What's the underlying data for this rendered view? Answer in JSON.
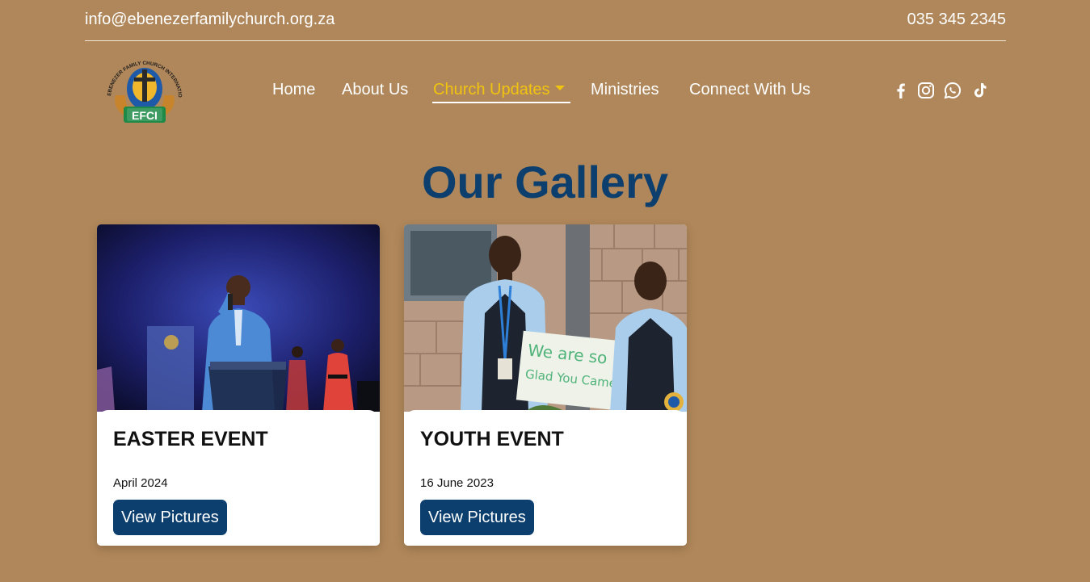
{
  "topbar": {
    "email": "info@ebenezerfamilychurch.org.za",
    "phone": "035 345 2345"
  },
  "logo": {
    "ring_text": "EBENEZER FAMILY CHURCH INTERNATIONAL",
    "badge_text": "EFCI"
  },
  "nav": {
    "items": [
      {
        "label": "Home"
      },
      {
        "label": "About Us"
      },
      {
        "label": "Church Updates"
      },
      {
        "label": "Ministries"
      },
      {
        "label": "Connect With Us"
      }
    ],
    "active_color": "#f1c40f"
  },
  "social": [
    "facebook-icon",
    "instagram-icon",
    "whatsapp-icon",
    "tiktok-icon"
  ],
  "gallery": {
    "title": "Our Gallery",
    "cards": [
      {
        "title": "EASTER EVENT",
        "date": "April 2024",
        "button": "View Pictures"
      },
      {
        "title": "YOUTH EVENT",
        "date": "16 June 2023",
        "button": "View Pictures",
        "sign_text": "We are so Glad You Came"
      }
    ]
  },
  "colors": {
    "background": "#b0875a",
    "title": "#0c3f6e",
    "button": "#0c3f6e"
  }
}
